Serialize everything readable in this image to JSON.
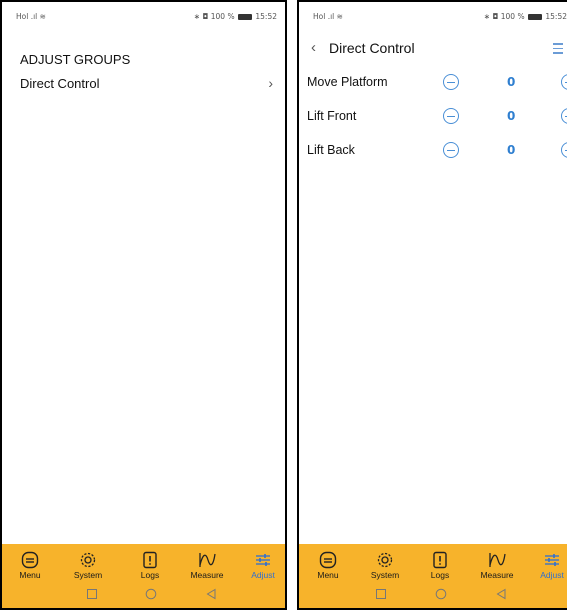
{
  "status": {
    "carrier": "Hol",
    "time": "15:52",
    "battery": "100 %"
  },
  "screen1": {
    "header": "ADJUST GROUPS",
    "items": [
      {
        "label": "Direct Control"
      }
    ]
  },
  "screen2": {
    "title": "Direct Control",
    "controls": [
      {
        "label": "Move Platform",
        "value": "0"
      },
      {
        "label": "Lift Front",
        "value": "0"
      },
      {
        "label": "Lift Back",
        "value": "0"
      }
    ]
  },
  "tabs": [
    {
      "label": "Menu",
      "icon": "menu-icon"
    },
    {
      "label": "System",
      "icon": "gear-icon"
    },
    {
      "label": "Logs",
      "icon": "logs-icon"
    },
    {
      "label": "Measure",
      "icon": "measure-icon"
    },
    {
      "label": "Adjust",
      "icon": "sliders-icon",
      "active": true
    }
  ],
  "colors": {
    "tabbar": "#f7b32b",
    "accent": "#2f6fd0",
    "value": "#2f7fd0"
  }
}
